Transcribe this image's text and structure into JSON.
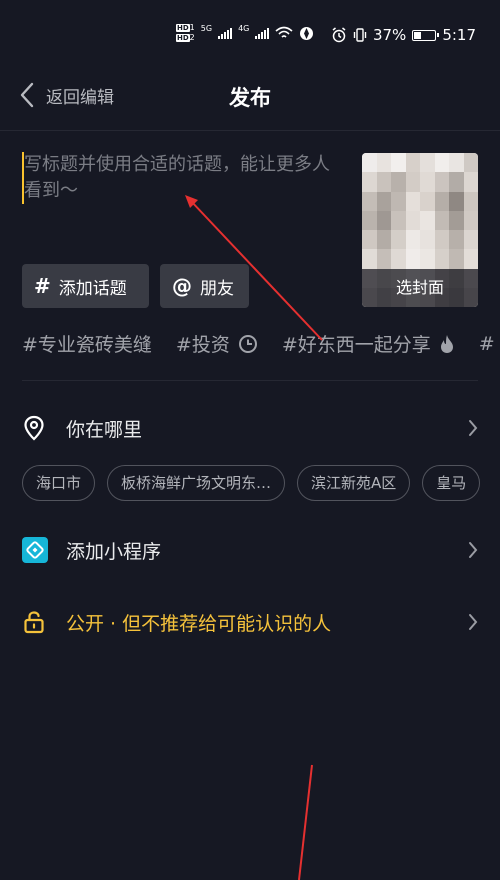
{
  "status_bar": {
    "hd1": "HD",
    "hd1_sub": "1",
    "hd2": "HD",
    "hd2_sub": "2",
    "net1": "5G",
    "net2": "4G",
    "battery_percent": "37%",
    "battery_level": 0.37,
    "time": "5:17"
  },
  "header": {
    "back_label": "返回编辑",
    "title": "发布"
  },
  "caption": {
    "placeholder": "写标题并使用合适的话题，能让更多人看到～"
  },
  "cover": {
    "label": "选封面"
  },
  "buttons": {
    "topic_symbol": "#",
    "topic_label": "添加话题",
    "friend_symbol": "@",
    "friend_label": "朋友"
  },
  "suggested_tags": [
    {
      "text": "#专业瓷砖美缝",
      "icon": ""
    },
    {
      "text": "#投资",
      "icon": "clock-icon"
    },
    {
      "text": "#好东西一起分享",
      "icon": "fire-icon"
    },
    {
      "text": "#",
      "icon": ""
    }
  ],
  "location": {
    "label": "你在哪里",
    "suggestions": [
      "海口市",
      "板桥海鲜广场文明东…",
      "滨江新苑A区",
      "皇马"
    ]
  },
  "mini_program": {
    "label": "添加小程序"
  },
  "privacy": {
    "label": "公开 · 但不推荐给可能认识的人"
  },
  "colors": {
    "background": "#161823",
    "accent": "#f5c23b",
    "chip_bg": "#393b44",
    "miniapp": "#16b6d8"
  }
}
